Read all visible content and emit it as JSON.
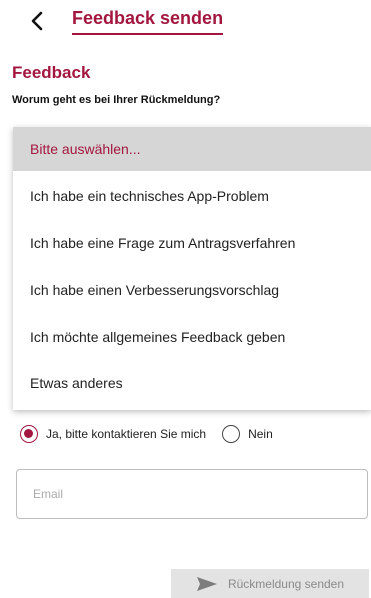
{
  "header": {
    "back_icon": "chevron-left-icon",
    "title": "Feedback senden"
  },
  "form": {
    "section_title": "Feedback",
    "question": "Worum geht es bei Ihrer Rückmeldung?",
    "topic_options": [
      {
        "label": "Bitte auswählen...",
        "selected": true
      },
      {
        "label": "Ich habe ein technisches App-Problem",
        "selected": false
      },
      {
        "label": "Ich habe eine Frage zum Antragsverfahren",
        "selected": false
      },
      {
        "label": "Ich habe einen Verbesserungsvorschlag",
        "selected": false
      },
      {
        "label": "Ich möchte allgemeines Feedback geben",
        "selected": false
      },
      {
        "label": "Etwas anderes",
        "selected": false
      }
    ],
    "contact_options": [
      {
        "label": "Ja, bitte kontaktieren Sie mich",
        "checked": true
      },
      {
        "label": "Nein",
        "checked": false
      }
    ],
    "email": {
      "value": "",
      "placeholder": "Email"
    },
    "submit": {
      "label": "Rückmeldung senden",
      "icon": "send-icon",
      "enabled": false
    }
  },
  "colors": {
    "accent": "#a3173f",
    "selected_bg": "#d6d6d6",
    "disabled_button_bg": "#e3e3e3",
    "disabled_text": "#8a8a8a"
  }
}
